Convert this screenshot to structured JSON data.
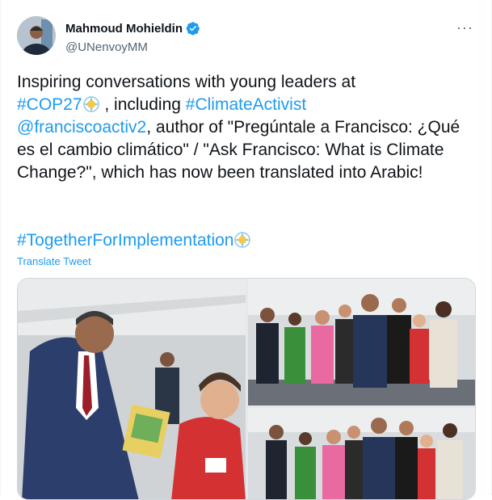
{
  "author": {
    "name": "Mahmoud Mohieldin",
    "handle": "@UNenvoyMM",
    "verified": true
  },
  "tweet": {
    "line1": "Inspiring conversations with young leaders at",
    "hashtag_cop": "#COP27",
    "after_cop": " , including ",
    "hashtag_activist": "#ClimateActivist",
    "mention": "@franciscoactiv2",
    "rest": ", author of \"Pregúntale a Francisco: ¿Qué es el cambio climático\" / \"Ask Francisco: What is Climate Change?\", which has now been translated into Arabic!",
    "hashtag_impl": "#TogetherForImplementation"
  },
  "actions": {
    "translate": "Translate Tweet",
    "more": "···"
  },
  "icons": {
    "verified": "verified-badge-icon",
    "cop_emoji": "cop27-logo-icon",
    "more": "more-icon"
  },
  "colors": {
    "link": "#1d9bf0",
    "text": "#0f1419",
    "secondary": "#536471"
  }
}
